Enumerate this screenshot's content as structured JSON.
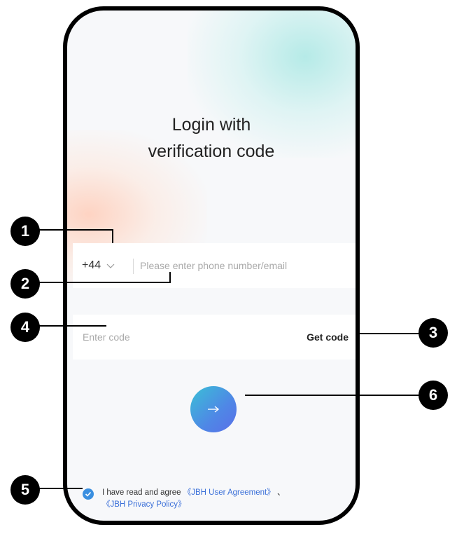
{
  "login": {
    "title_line1": "Login with",
    "title_line2": "verification code",
    "country_code": "+44",
    "phone_placeholder": "Please enter phone number/email",
    "code_placeholder": "Enter code",
    "get_code_label": "Get code",
    "agreement": {
      "prefix": "I have read and agree",
      "user_agreement": "《JBH User Agreement》",
      "separator": "、",
      "privacy_policy": "《JBH Privacy Policy》"
    }
  },
  "callouts": {
    "c1": "1",
    "c2": "2",
    "c3": "3",
    "c4": "4",
    "c5": "5",
    "c6": "6"
  },
  "icons": {
    "country_dropdown": "chevron-down-icon",
    "submit": "arrow-right-icon",
    "checkbox": "checkmark-icon"
  },
  "colors": {
    "accent_gradient_start": "#3ac0d6",
    "accent_gradient_end": "#5a6fe8",
    "link": "#3a6fd8",
    "checkbox": "#3a8fe0"
  }
}
